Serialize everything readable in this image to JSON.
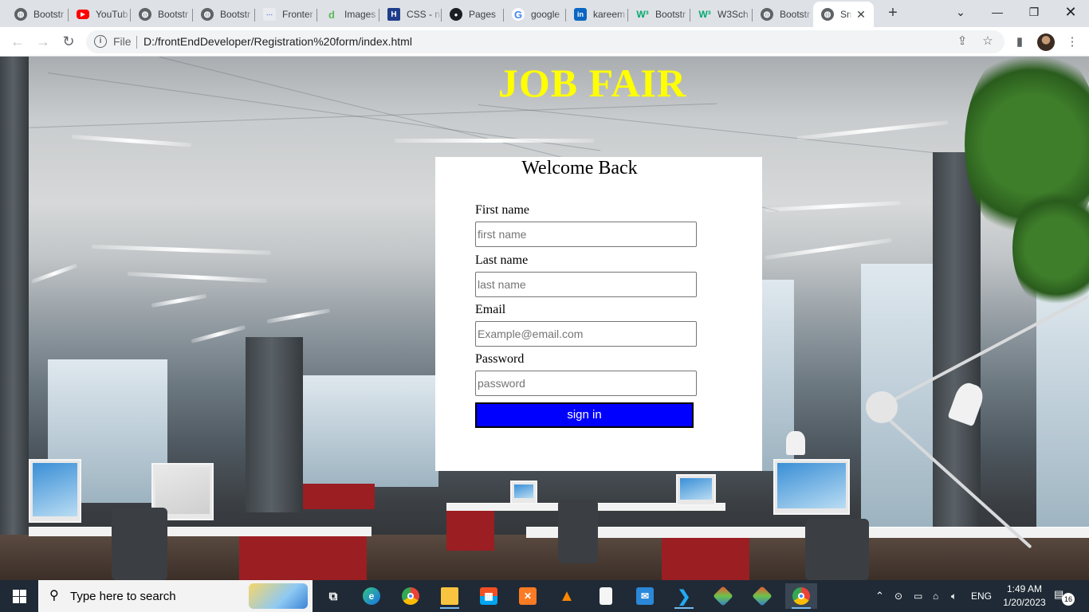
{
  "browser": {
    "tabs": [
      {
        "title": "Bootstr",
        "icon": "globe-icon"
      },
      {
        "title": "YouTub",
        "icon": "youtube-icon"
      },
      {
        "title": "Bootstr",
        "icon": "globe-icon"
      },
      {
        "title": "Bootstr",
        "icon": "globe-icon"
      },
      {
        "title": "Fronter",
        "icon": "frontend-icon"
      },
      {
        "title": "Images",
        "icon": "d-icon"
      },
      {
        "title": "CSS - n",
        "icon": "h-icon"
      },
      {
        "title": "Pages",
        "icon": "github-icon"
      },
      {
        "title": "google",
        "icon": "google-icon"
      },
      {
        "title": "kareem",
        "icon": "linkedin-icon"
      },
      {
        "title": "Bootstr",
        "icon": "w3schools-icon"
      },
      {
        "title": "W3Sch",
        "icon": "w3schools-icon"
      },
      {
        "title": "Bootstr",
        "icon": "globe-icon"
      },
      {
        "title": "Sm",
        "icon": "globe-icon",
        "active": true
      }
    ],
    "address": {
      "scheme_label": "File",
      "url": "D:/frontEndDeveloper/Registration%20form/index.html"
    }
  },
  "page": {
    "title": "JOB FAIR",
    "form": {
      "heading": "Welcome Back",
      "fields": [
        {
          "label": "First name",
          "placeholder": "first name",
          "value": ""
        },
        {
          "label": "Last name",
          "placeholder": "last name",
          "value": ""
        },
        {
          "label": "Email",
          "placeholder": "Example@email.com",
          "value": ""
        },
        {
          "label": "Password",
          "placeholder": "password",
          "value": ""
        }
      ],
      "submit_label": "sign in"
    },
    "colors": {
      "title": "#ffff00",
      "button": "#0000ff",
      "card": "#ffffff"
    }
  },
  "taskbar": {
    "search_placeholder": "Type here to search",
    "language": "ENG",
    "time": "1:49 AM",
    "date": "1/20/2023",
    "notification_count": "16"
  }
}
